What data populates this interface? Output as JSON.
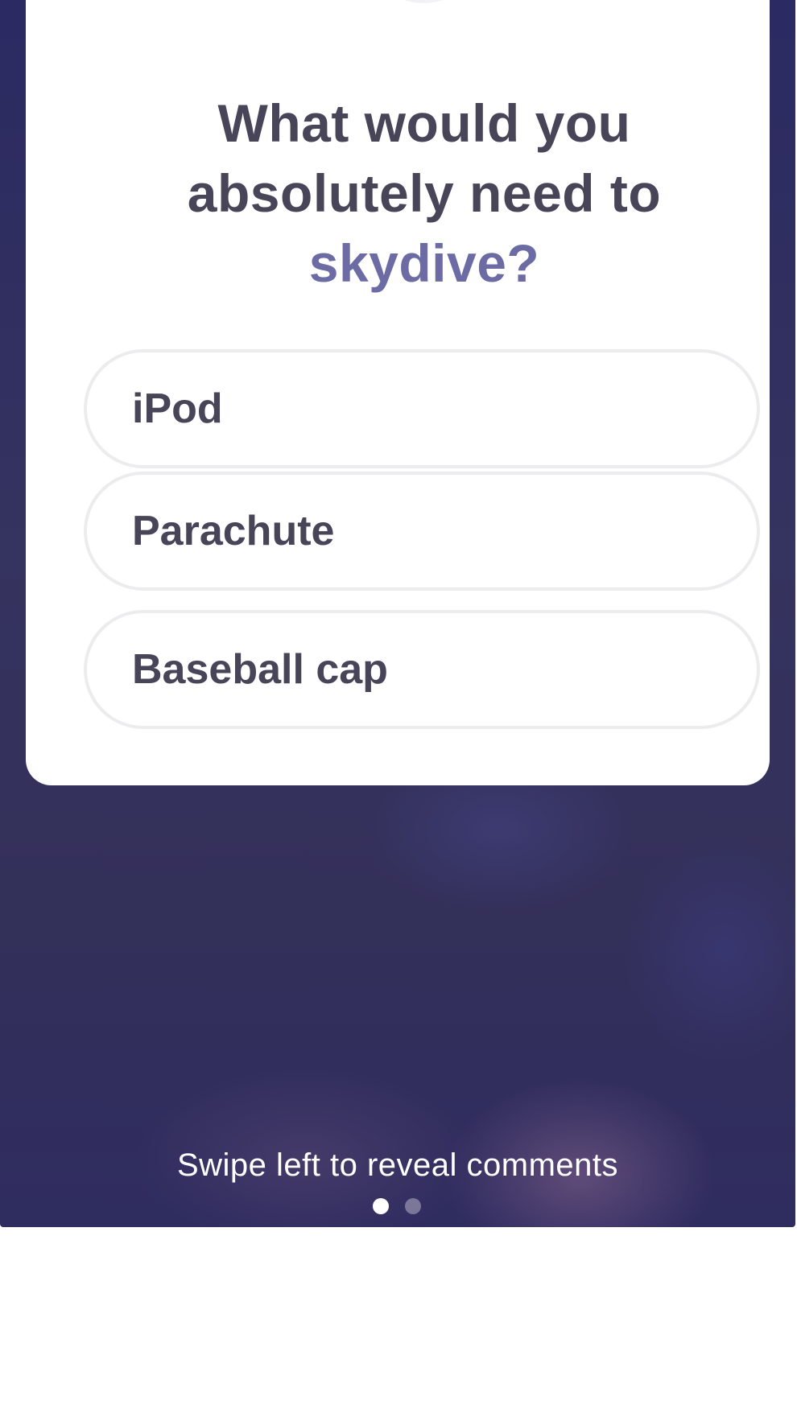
{
  "question": {
    "line1": "What would you",
    "line2": "absolutely need to",
    "highlight": "skydive?"
  },
  "options": [
    {
      "label": "iPod"
    },
    {
      "label": "Parachute"
    },
    {
      "label": "Baseball cap"
    }
  ],
  "footer": {
    "hint": "Swipe left to reveal comments",
    "page_indicator": {
      "current": 1,
      "total": 2
    }
  },
  "colors": {
    "background": "#2f2d62",
    "question_text": "#474557",
    "highlight": "#6c6ba3",
    "option_border": "#ececee"
  }
}
